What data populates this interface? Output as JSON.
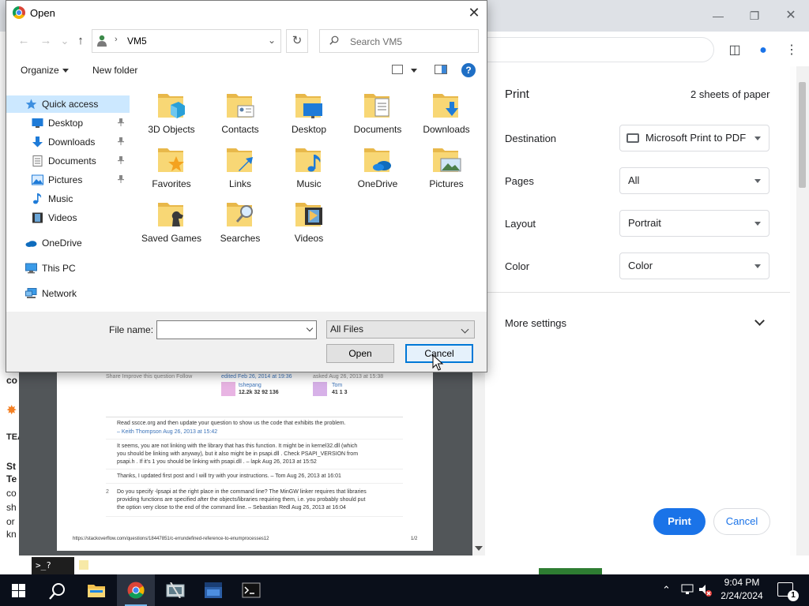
{
  "dialog": {
    "title": "Open",
    "address": {
      "path_label": "VM5"
    },
    "search_placeholder": "Search VM5",
    "commands": {
      "organize": "Organize",
      "new_folder": "New folder"
    },
    "nav": [
      {
        "label": "Quick access",
        "icon": "star-icon",
        "selected": true
      },
      {
        "label": "Desktop",
        "icon": "desktop-icon",
        "pinned": true
      },
      {
        "label": "Downloads",
        "icon": "download-arrow-icon",
        "pinned": true
      },
      {
        "label": "Documents",
        "icon": "document-icon",
        "pinned": true
      },
      {
        "label": "Pictures",
        "icon": "pictures-icon",
        "pinned": true
      },
      {
        "label": "Music",
        "icon": "music-note-icon"
      },
      {
        "label": "Videos",
        "icon": "film-icon"
      },
      {
        "label": "OneDrive",
        "icon": "cloud-icon"
      },
      {
        "label": "This PC",
        "icon": "monitor-icon"
      },
      {
        "label": "Network",
        "icon": "network-icon"
      }
    ],
    "folders": [
      {
        "label": "3D Objects",
        "overlay": "cube-icon"
      },
      {
        "label": "Contacts",
        "overlay": "contact-card-icon"
      },
      {
        "label": "Desktop",
        "overlay": "desktop-icon"
      },
      {
        "label": "Documents",
        "overlay": "document-icon"
      },
      {
        "label": "Downloads",
        "overlay": "download-arrow-icon"
      },
      {
        "label": "Favorites",
        "overlay": "star-icon"
      },
      {
        "label": "Links",
        "overlay": "link-arrow-icon"
      },
      {
        "label": "Music",
        "overlay": "music-note-icon"
      },
      {
        "label": "OneDrive",
        "overlay": "cloud-icon"
      },
      {
        "label": "Pictures",
        "overlay": "landscape-icon"
      },
      {
        "label": "Saved Games",
        "overlay": "chess-icon"
      },
      {
        "label": "Searches",
        "overlay": "magnifier-icon"
      },
      {
        "label": "Videos",
        "overlay": "film-icon"
      }
    ],
    "file_name_label": "File name:",
    "file_name_value": "",
    "file_type": "All Files",
    "open_label": "Open",
    "cancel_label": "Cancel"
  },
  "print": {
    "title": "Print",
    "sheets": "2 sheets of paper",
    "destination_label": "Destination",
    "destination_value": "Microsoft Print to PDF",
    "pages_label": "Pages",
    "pages_value": "All",
    "layout_label": "Layout",
    "layout_value": "Portrait",
    "color_label": "Color",
    "color_value": "Color",
    "more_settings": "More settings",
    "print_label": "Print",
    "cancel_label": "Cancel"
  },
  "preview": {
    "share_line": "Share  Improve this question  Follow",
    "edited": "edited Feb 26, 2014 at 19:36",
    "asked": "asked Aug 26, 2013 at 15:38",
    "editor_name": "tshepang",
    "editor_stats": "12.2k   32   92   136",
    "asker_name": "Tom",
    "asker_stats": "41   1   3",
    "comment1": "Read sscce.org and then update your question to show us the code that exhibits the problem.",
    "comment1_author": "– Keith Thompson Aug 26, 2013 at 15:42",
    "comment2a": "It seems, you are not linking with the library that has this function. It might be in  kernel32.dll  (which",
    "comment2b": "you should be linking with anyway), but it also might be in  psapi.dll . Check  PSAPI_VERSION  from",
    "comment2c": "psapi.h . If it's  1  you should be linking with  psapi.dll . – lapk Aug 26, 2013 at 15:52",
    "comment3": "Thanks, I updated first post and I will try with your instructions. –  Tom  Aug 26, 2013 at 16:01",
    "comment4_num": "2",
    "comment4a": "Do you specify  -lpsapi  at the right place in the command line? The MinGW linker requires that libraries",
    "comment4b": "providing functions are specified after the objects/libraries requiring them, i.e. you probably should put",
    "comment4c": "the option very close to the end of the command line. – Sebastian Redl Aug 26, 2013 at 16:04",
    "footer_url": "https://stackoverflow.com/questions/18447851/c-errundefined-reference-to-enumprocesses12",
    "footer_page": "1/2"
  },
  "left_fragments": [
    "co",
    "TEA",
    "St",
    "Te",
    "co",
    "sh",
    "or",
    "kn"
  ],
  "bottom": {
    "terminal_chip": ">_?"
  },
  "taskbar": {
    "time": "9:04 PM",
    "date": "2/24/2024",
    "notification_count": "1"
  }
}
